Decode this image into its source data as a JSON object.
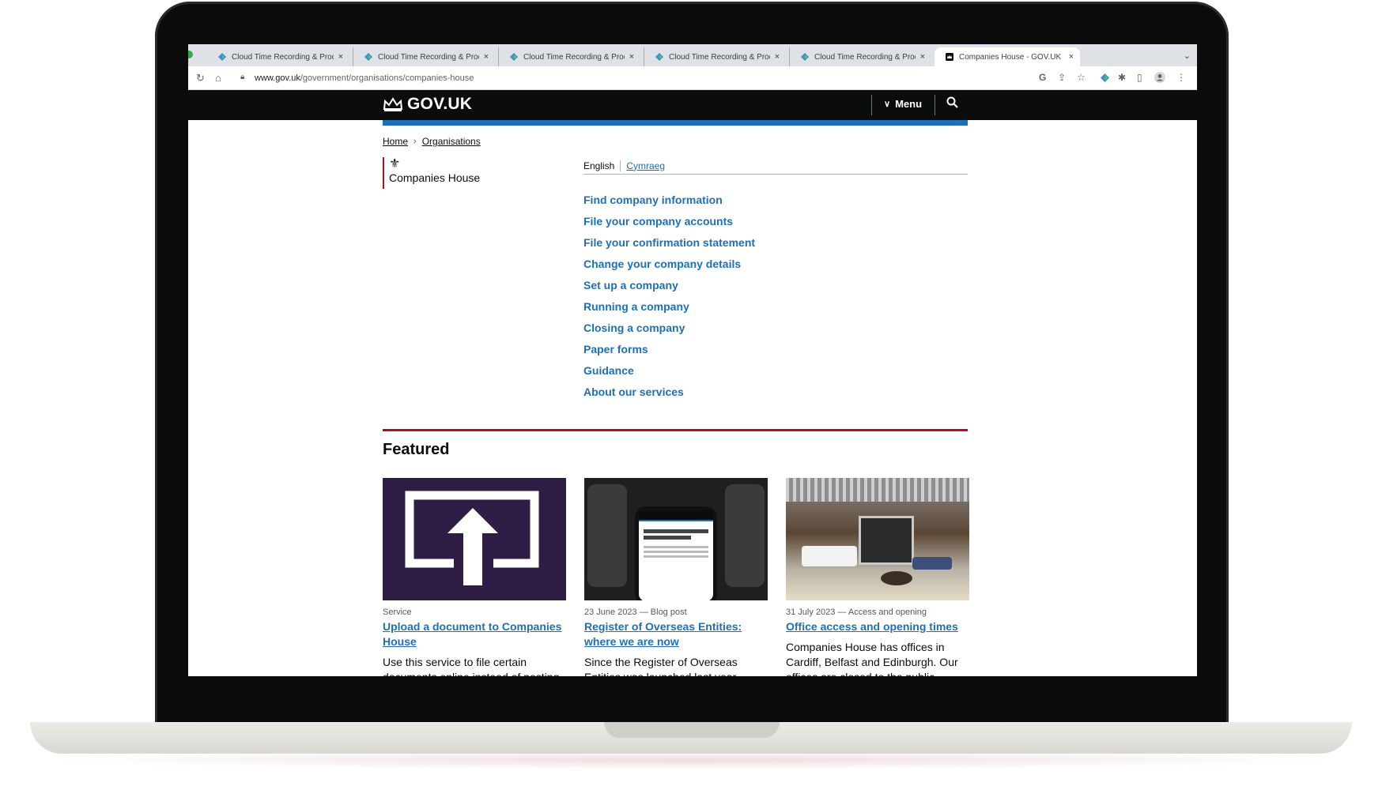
{
  "browser": {
    "tabs": [
      {
        "title": "Cloud Time Recording & Produ",
        "active": false
      },
      {
        "title": "Cloud Time Recording & Produ",
        "active": false
      },
      {
        "title": "Cloud Time Recording & Produ",
        "active": false
      },
      {
        "title": "Cloud Time Recording & Produ",
        "active": false
      },
      {
        "title": "Cloud Time Recording & Produ",
        "active": false
      },
      {
        "title": "Companies House - GOV.UK",
        "active": true
      }
    ],
    "close_glyph": "×",
    "url_host": "www.gov.uk",
    "url_path": "/government/organisations/companies-house"
  },
  "header": {
    "logo_text": "GOV.UK",
    "menu_label": "Menu"
  },
  "breadcrumbs": [
    "Home",
    "Organisations"
  ],
  "organisation": {
    "name": "Companies House"
  },
  "language": {
    "current": "English",
    "alternate": "Cymraeg"
  },
  "quick_links": [
    "Find company information",
    "File your company accounts",
    "File your confirmation statement",
    "Change your company details",
    "Set up a company",
    "Running a company",
    "Closing a company",
    "Paper forms",
    "Guidance",
    "About our services"
  ],
  "featured": {
    "heading": "Featured",
    "cards": [
      {
        "meta": "Service",
        "title": "Upload a document to Companies House",
        "description": "Use this service to file certain documents online instead of posting"
      },
      {
        "meta": "23 June 2023 — Blog post",
        "title": "Register of Overseas Entities: where we are now",
        "description": "Since the Register of Overseas Entities was launched last year"
      },
      {
        "meta": "31 July 2023 — Access and opening",
        "title": "Office access and opening times",
        "description": "Companies House has offices in Cardiff, Belfast and Edinburgh. Our offices are closed to the public"
      }
    ]
  },
  "colors": {
    "govuk_black": "#0b0c0c",
    "link_blue": "#1d70b8",
    "brand_blue_bar": "#1d70b8",
    "companies_house_red": "#b10e1e",
    "upload_card_purple": "#2e1d45"
  }
}
